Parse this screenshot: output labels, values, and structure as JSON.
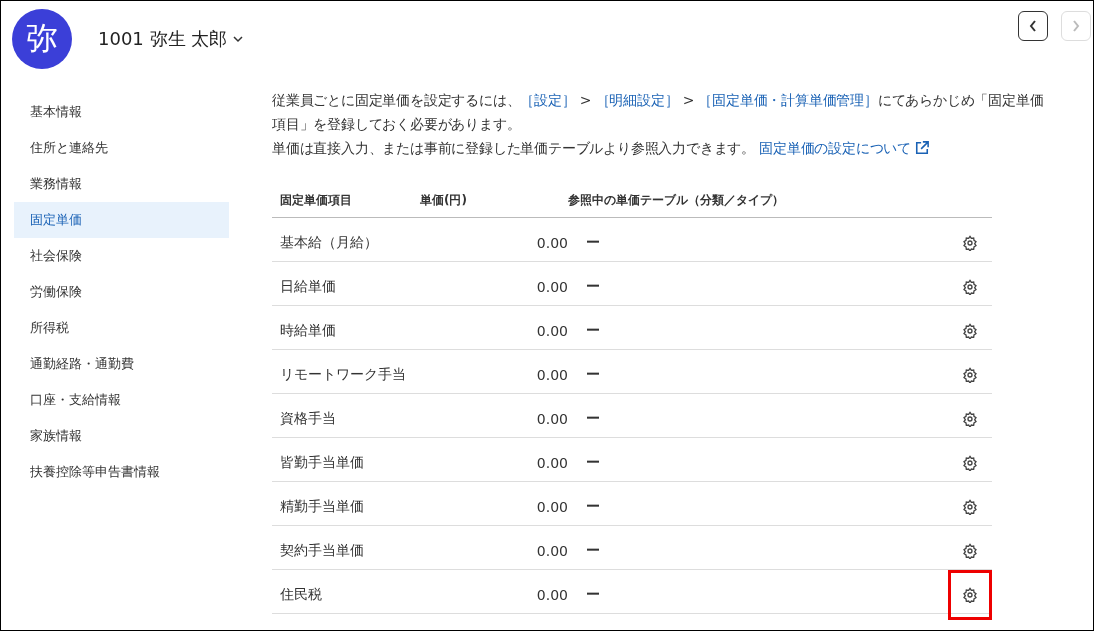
{
  "header": {
    "avatar": "弥",
    "employee": "1001 弥生 太郎",
    "prev_disabled": false,
    "next_disabled": true
  },
  "sidebar": {
    "items": [
      {
        "label": "基本情報",
        "selected": false
      },
      {
        "label": "住所と連絡先",
        "selected": false
      },
      {
        "label": "業務情報",
        "selected": false
      },
      {
        "label": "固定単価",
        "selected": true
      },
      {
        "label": "社会保険",
        "selected": false
      },
      {
        "label": "労働保険",
        "selected": false
      },
      {
        "label": "所得税",
        "selected": false
      },
      {
        "label": "通勤経路・通勤費",
        "selected": false
      },
      {
        "label": "口座・支給情報",
        "selected": false
      },
      {
        "label": "家族情報",
        "selected": false
      },
      {
        "label": "扶養控除等申告書情報",
        "selected": false
      }
    ]
  },
  "notice": [
    [
      {
        "kind": "text",
        "text": "従業員ごとに固定単価を設定するには、"
      },
      {
        "kind": "link",
        "text": "［設定］"
      },
      {
        "kind": "text",
        "text": " > "
      },
      {
        "kind": "link",
        "text": "［明細設定］"
      },
      {
        "kind": "text",
        "text": " > "
      },
      {
        "kind": "link",
        "text": "［固定単価・計算単価管理］"
      },
      {
        "kind": "text",
        "text": "にてあらかじめ「固定単価項目」を登録しておく必要があります。"
      }
    ],
    [
      {
        "kind": "text",
        "text": "単価は直接入力、または事前に登録した単価テーブルより参照入力できます。 "
      },
      {
        "kind": "external",
        "text": "固定単価の設定について"
      }
    ]
  ],
  "table": {
    "columns": [
      "固定単価項目",
      "単価(円)",
      "参照中の単価テーブル（分類／タイプ）"
    ],
    "rows": [
      {
        "item": "基本給（月給）",
        "price": "0.00",
        "ref": "ー",
        "highlighted": false
      },
      {
        "item": "日給単価",
        "price": "0.00",
        "ref": "ー",
        "highlighted": false
      },
      {
        "item": "時給単価",
        "price": "0.00",
        "ref": "ー",
        "highlighted": false
      },
      {
        "item": "リモートワーク手当",
        "price": "0.00",
        "ref": "ー",
        "highlighted": false
      },
      {
        "item": "資格手当",
        "price": "0.00",
        "ref": "ー",
        "highlighted": false
      },
      {
        "item": "皆勤手当単価",
        "price": "0.00",
        "ref": "ー",
        "highlighted": false
      },
      {
        "item": "精勤手当単価",
        "price": "0.00",
        "ref": "ー",
        "highlighted": false
      },
      {
        "item": "契約手当単価",
        "price": "0.00",
        "ref": "ー",
        "highlighted": false
      },
      {
        "item": "住民税",
        "price": "0.00",
        "ref": "ー",
        "highlighted": true
      }
    ]
  }
}
